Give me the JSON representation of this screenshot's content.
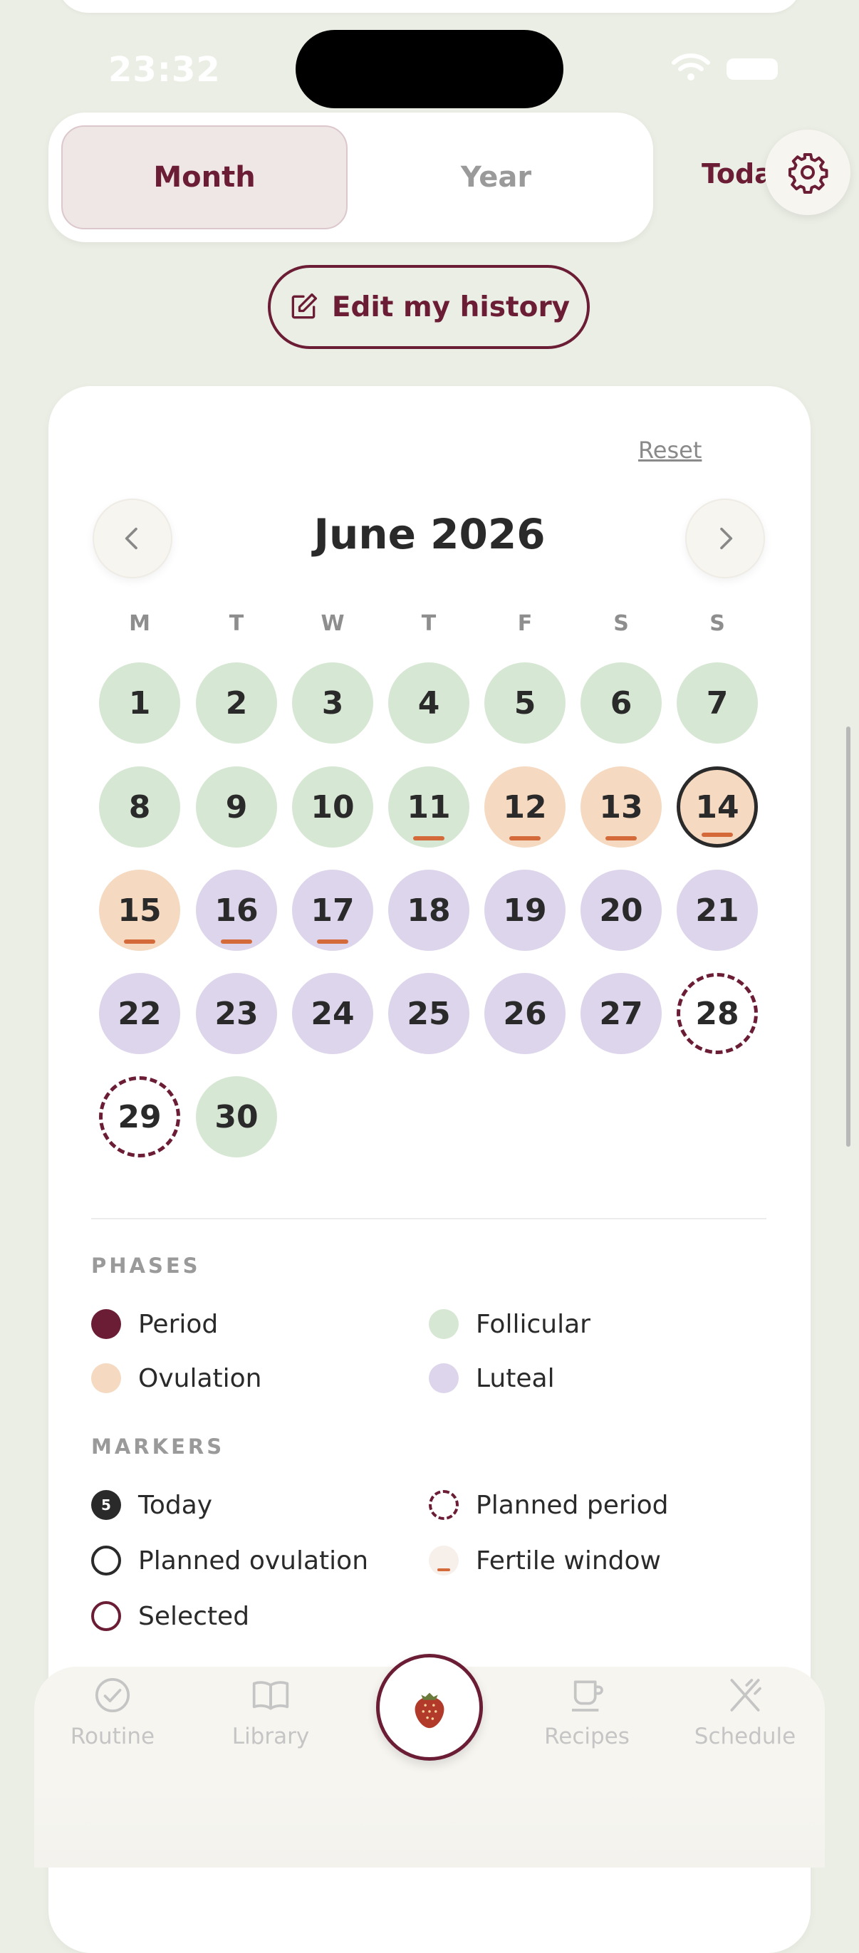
{
  "status": {
    "time": "23:32"
  },
  "segmented": {
    "month": "Month",
    "year": "Year"
  },
  "header": {
    "today_link": "Today"
  },
  "edit_history": "Edit my history",
  "calendar": {
    "reset": "Reset",
    "month_title": "June 2026",
    "weekdays": [
      "M",
      "T",
      "W",
      "T",
      "F",
      "S",
      "S"
    ],
    "days": [
      {
        "n": "1",
        "phase": "follicular"
      },
      {
        "n": "2",
        "phase": "follicular"
      },
      {
        "n": "3",
        "phase": "follicular"
      },
      {
        "n": "4",
        "phase": "follicular"
      },
      {
        "n": "5",
        "phase": "follicular"
      },
      {
        "n": "6",
        "phase": "follicular"
      },
      {
        "n": "7",
        "phase": "follicular"
      },
      {
        "n": "8",
        "phase": "follicular"
      },
      {
        "n": "9",
        "phase": "follicular"
      },
      {
        "n": "10",
        "phase": "follicular"
      },
      {
        "n": "11",
        "phase": "follicular",
        "fertile": true
      },
      {
        "n": "12",
        "phase": "ovulation",
        "fertile": true
      },
      {
        "n": "13",
        "phase": "ovulation",
        "fertile": true
      },
      {
        "n": "14",
        "phase": "ovulation",
        "fertile": true,
        "today": true
      },
      {
        "n": "15",
        "phase": "ovulation",
        "fertile": true
      },
      {
        "n": "16",
        "phase": "luteal",
        "fertile": true
      },
      {
        "n": "17",
        "phase": "luteal",
        "fertile": true
      },
      {
        "n": "18",
        "phase": "luteal"
      },
      {
        "n": "19",
        "phase": "luteal"
      },
      {
        "n": "20",
        "phase": "luteal"
      },
      {
        "n": "21",
        "phase": "luteal"
      },
      {
        "n": "22",
        "phase": "luteal"
      },
      {
        "n": "23",
        "phase": "luteal"
      },
      {
        "n": "24",
        "phase": "luteal"
      },
      {
        "n": "25",
        "phase": "luteal"
      },
      {
        "n": "26",
        "phase": "luteal"
      },
      {
        "n": "27",
        "phase": "luteal"
      },
      {
        "n": "28",
        "phase": "planned"
      },
      {
        "n": "29",
        "phase": "planned"
      },
      {
        "n": "30",
        "phase": "follicular"
      }
    ]
  },
  "legend": {
    "phases_title": "PHASES",
    "period": "Period",
    "follicular": "Follicular",
    "ovulation": "Ovulation",
    "luteal": "Luteal",
    "markers_title": "MARKERS",
    "today_sample": "5",
    "today": "Today",
    "planned_period": "Planned period",
    "planned_ovulation": "Planned ovulation",
    "fertile_window": "Fertile window",
    "selected": "Selected"
  },
  "colors": {
    "accent": "#6b1d35",
    "follicular": "#d6e8d3",
    "ovulation": "#f5d9c0",
    "luteal": "#ddd5eb",
    "fertile_marker": "#d46a3a"
  },
  "tabs": [
    "Routine",
    "Library",
    "Recipes",
    "Schedule"
  ],
  "icons": [
    "gear-icon",
    "edit-icon",
    "chevron-left-icon",
    "chevron-right-icon",
    "check-circle-icon",
    "book-icon",
    "strawberry-icon",
    "cup-icon",
    "utensils-icon"
  ]
}
